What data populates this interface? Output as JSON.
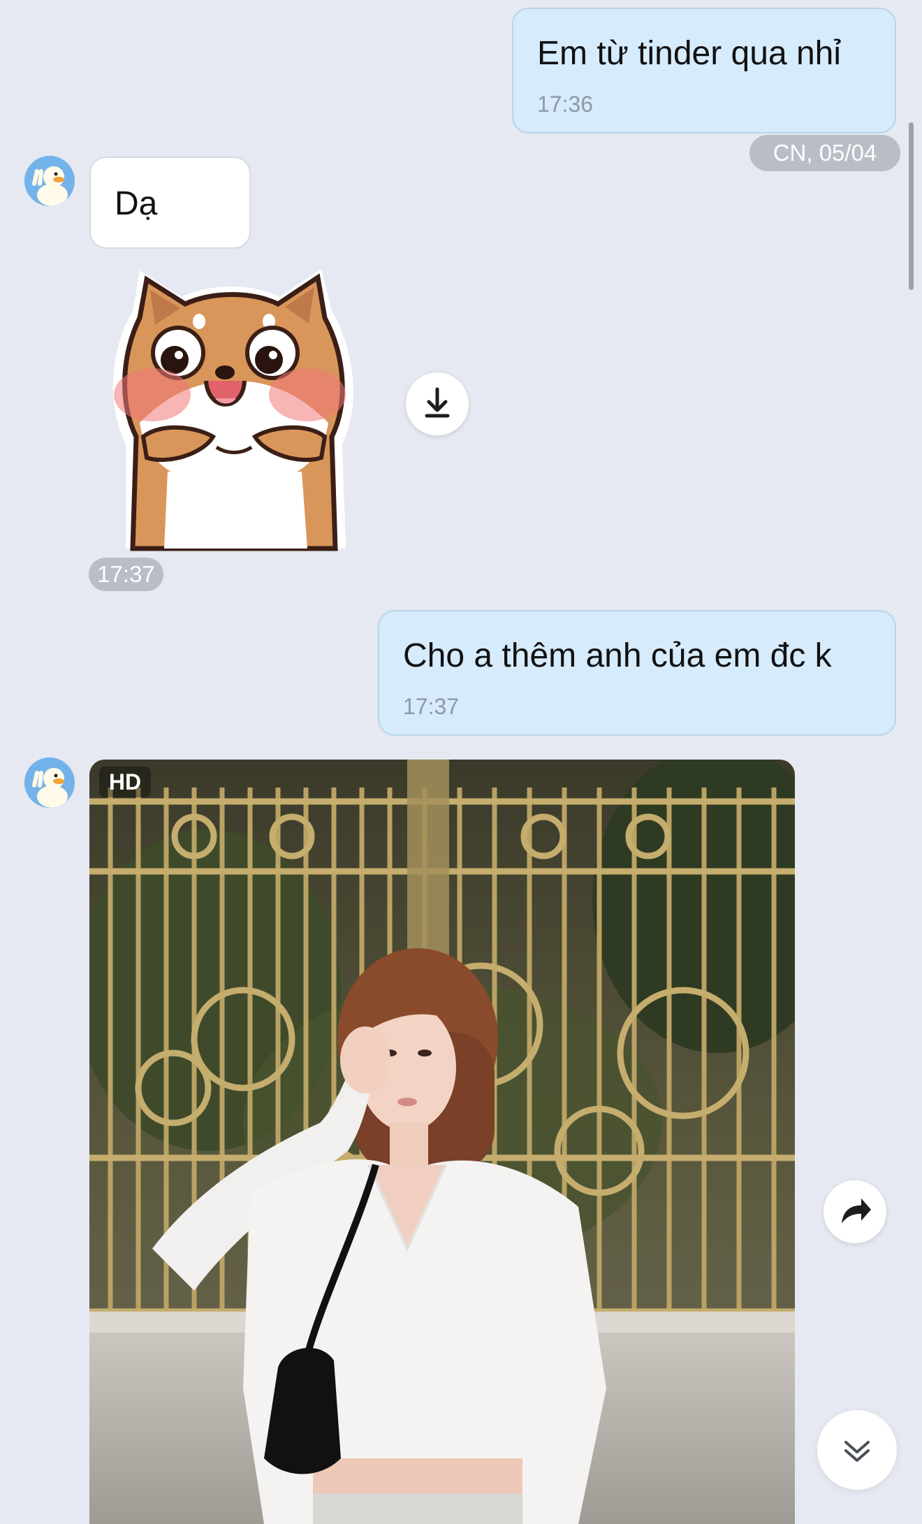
{
  "messages": {
    "m1": {
      "text": "Em từ tinder qua nhỉ",
      "time": "17:36"
    },
    "date_separator": "CN, 05/04",
    "m2": {
      "text": "Dạ"
    },
    "sticker": {
      "time": "17:37",
      "description_icon": "shiba-dog-sticker"
    },
    "m3": {
      "text": "Cho a thêm anh của em đc k",
      "time": "17:37"
    },
    "photo": {
      "badge": "HD"
    }
  },
  "icons": {
    "download": "download-icon",
    "forward": "forward-icon",
    "scroll_down": "chevron-double-down-icon"
  },
  "colors": {
    "background": "#e6e9f1",
    "outgoing_bubble": "#d6ebfc",
    "incoming_bubble": "#ffffff",
    "time_text": "#8f98a3",
    "pill": "#b8bdc6"
  }
}
